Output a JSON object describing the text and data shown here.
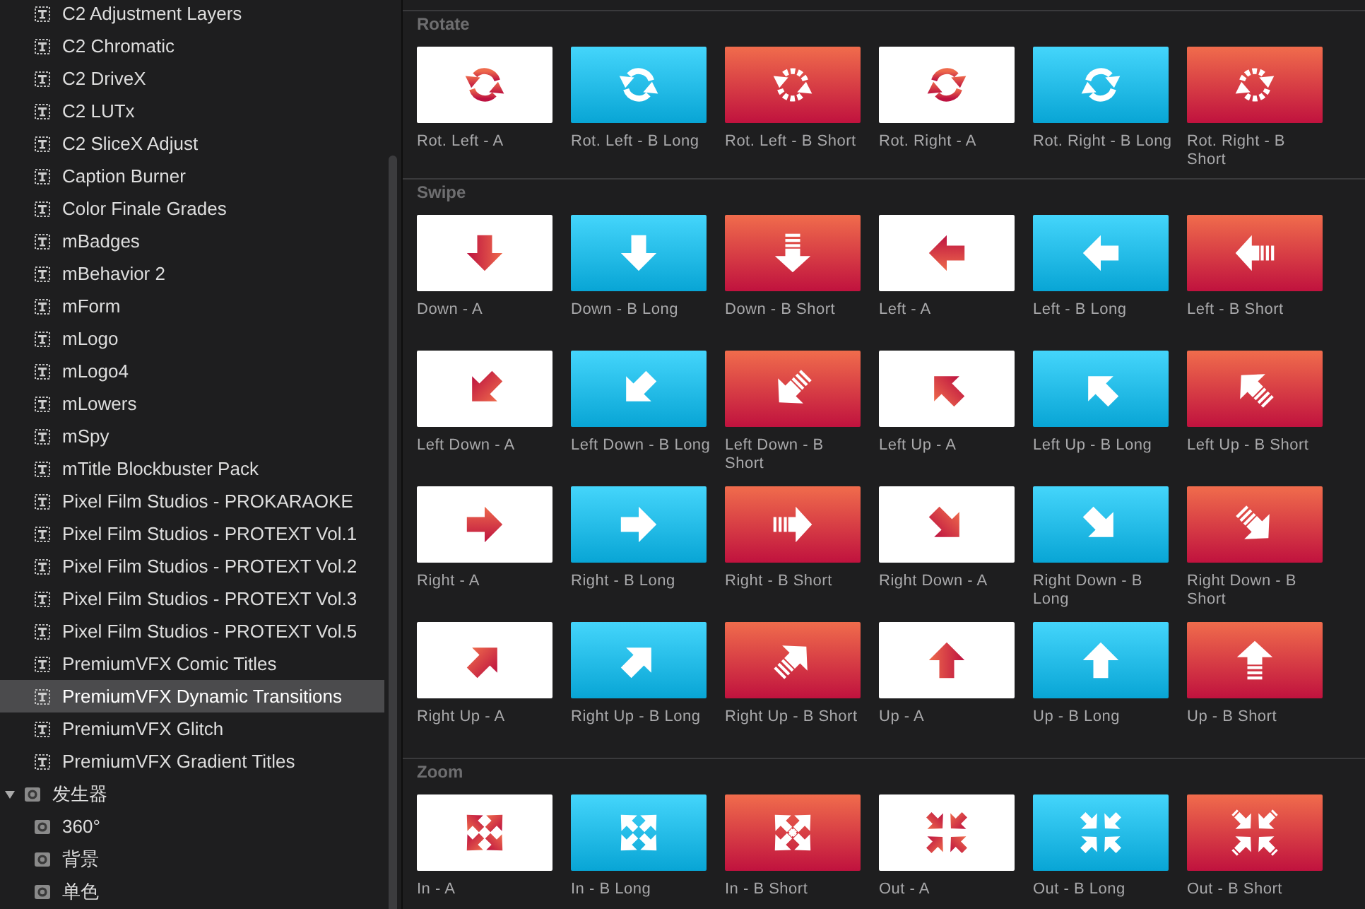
{
  "sidebar": {
    "items": [
      {
        "kind": "title",
        "label": "C2 Adjustment Layers",
        "selected": false
      },
      {
        "kind": "title",
        "label": "C2 Chromatic",
        "selected": false
      },
      {
        "kind": "title",
        "label": "C2 DriveX",
        "selected": false
      },
      {
        "kind": "title",
        "label": "C2 LUTx",
        "selected": false
      },
      {
        "kind": "title",
        "label": "C2 SliceX Adjust",
        "selected": false
      },
      {
        "kind": "title",
        "label": "Caption Burner",
        "selected": false
      },
      {
        "kind": "title",
        "label": "Color Finale Grades",
        "selected": false
      },
      {
        "kind": "title",
        "label": "mBadges",
        "selected": false
      },
      {
        "kind": "title",
        "label": "mBehavior 2",
        "selected": false
      },
      {
        "kind": "title",
        "label": "mForm",
        "selected": false
      },
      {
        "kind": "title",
        "label": "mLogo",
        "selected": false
      },
      {
        "kind": "title",
        "label": "mLogo4",
        "selected": false
      },
      {
        "kind": "title",
        "label": "mLowers",
        "selected": false
      },
      {
        "kind": "title",
        "label": "mSpy",
        "selected": false
      },
      {
        "kind": "title",
        "label": "mTitle Blockbuster Pack",
        "selected": false
      },
      {
        "kind": "title",
        "label": "Pixel Film Studios - PROKARAOKE",
        "selected": false
      },
      {
        "kind": "title",
        "label": "Pixel Film Studios - PROTEXT Vol.1",
        "selected": false
      },
      {
        "kind": "title",
        "label": "Pixel Film Studios - PROTEXT Vol.2",
        "selected": false
      },
      {
        "kind": "title",
        "label": "Pixel Film Studios - PROTEXT Vol.3",
        "selected": false
      },
      {
        "kind": "title",
        "label": "Pixel Film Studios - PROTEXT Vol.5",
        "selected": false
      },
      {
        "kind": "title",
        "label": "PremiumVFX Comic Titles",
        "selected": false
      },
      {
        "kind": "title",
        "label": "PremiumVFX Dynamic Transitions",
        "selected": true
      },
      {
        "kind": "title",
        "label": "PremiumVFX Glitch",
        "selected": false
      },
      {
        "kind": "title",
        "label": "PremiumVFX Gradient Titles",
        "selected": false
      },
      {
        "kind": "generator",
        "label": "发生器",
        "selected": false,
        "expanded": true,
        "children": [
          {
            "kind": "generator",
            "label": "360°",
            "selected": false
          },
          {
            "kind": "generator",
            "label": "背景",
            "selected": false
          },
          {
            "kind": "generator",
            "label": "单色",
            "selected": false
          }
        ]
      }
    ]
  },
  "sections": [
    {
      "kind": "rotate",
      "title": "Rotate",
      "items": [
        {
          "label": "Rot. Left - A"
        },
        {
          "label": "Rot. Left - B Long"
        },
        {
          "label": "Rot. Left - B Short"
        },
        {
          "label": "Rot. Right - A"
        },
        {
          "label": "Rot. Right - B Long"
        },
        {
          "label": "Rot. Right - B Short"
        }
      ]
    },
    {
      "kind": "swipe",
      "title": "Swipe",
      "items": [
        {
          "label": "Down - A"
        },
        {
          "label": "Down - B Long"
        },
        {
          "label": "Down - B Short"
        },
        {
          "label": "Left - A"
        },
        {
          "label": "Left - B Long"
        },
        {
          "label": "Left - B Short"
        },
        {
          "label": "Left Down - A"
        },
        {
          "label": "Left Down - B Long"
        },
        {
          "label": "Left Down - B Short"
        },
        {
          "label": "Left Up - A"
        },
        {
          "label": "Left Up - B Long"
        },
        {
          "label": "Left Up - B Short"
        },
        {
          "label": "Right - A"
        },
        {
          "label": "Right - B Long"
        },
        {
          "label": "Right - B Short"
        },
        {
          "label": "Right Down - A"
        },
        {
          "label": "Right Down - B Long"
        },
        {
          "label": "Right Down - B Short"
        },
        {
          "label": "Right Up - A"
        },
        {
          "label": "Right Up - B Long"
        },
        {
          "label": "Right Up - B Short"
        },
        {
          "label": "Up - A"
        },
        {
          "label": "Up - B Long"
        },
        {
          "label": "Up - B Short"
        }
      ]
    },
    {
      "kind": "zoom",
      "title": "Zoom",
      "items": [
        {
          "label": "In - A"
        },
        {
          "label": "In - B Long"
        },
        {
          "label": "In - B Short"
        },
        {
          "label": "Out - A"
        },
        {
          "label": "Out - B Long"
        },
        {
          "label": "Out - B Short"
        }
      ]
    }
  ]
}
